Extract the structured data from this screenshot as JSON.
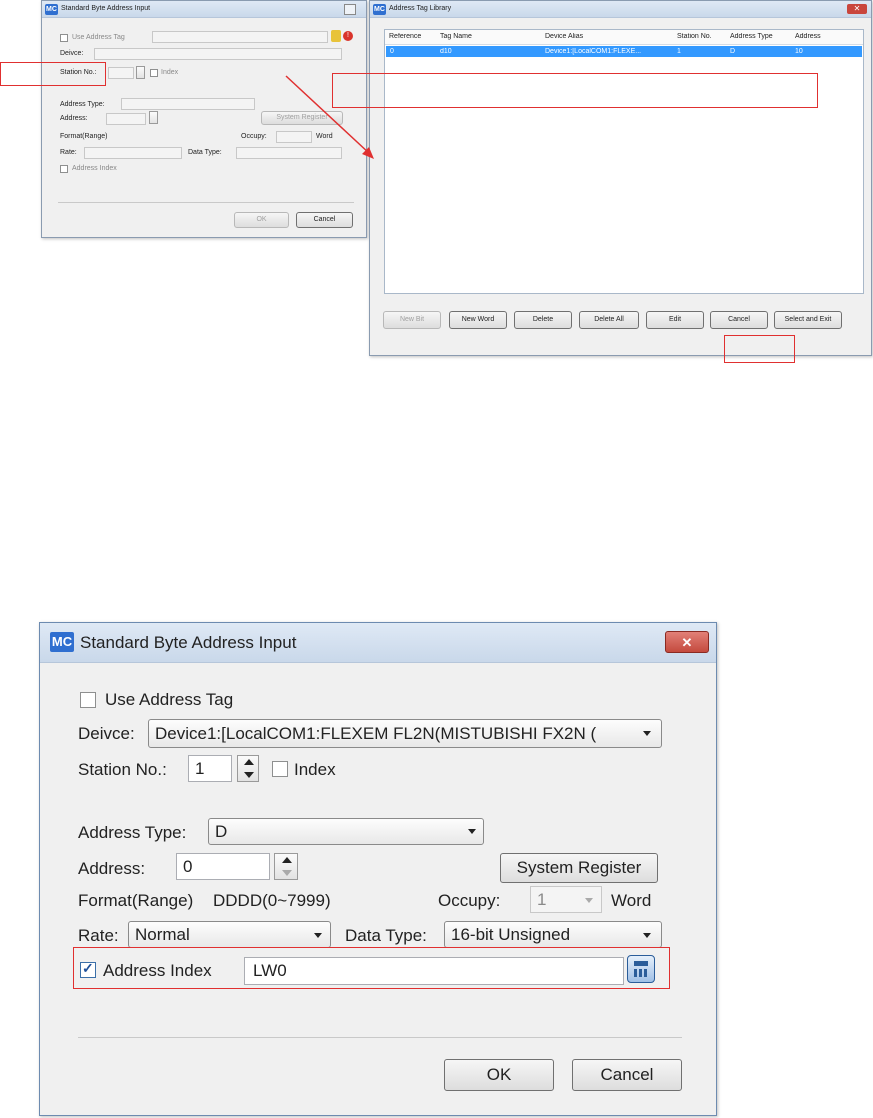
{
  "top_left_dialog": {
    "title": "Standard Byte Address Input",
    "use_address_tag": "Use Address Tag",
    "device_label": "Deivce:",
    "station_label": "Station No.:",
    "index_label": "Index",
    "address_type_label": "Address Type:",
    "address_label": "Address:",
    "system_register": "System Register",
    "format_range_label": "Format(Range)",
    "occupy_label": "Occupy:",
    "word_label": "Word",
    "rate_label": "Rate:",
    "data_type_label": "Data Type:",
    "address_index_label": "Address Index",
    "ok": "OK",
    "cancel": "Cancel"
  },
  "library": {
    "title": "Address Tag Library",
    "columns": [
      "Reference",
      "Tag Name",
      "Device Alias",
      "Station No.",
      "Address Type",
      "Address"
    ],
    "rows": [
      [
        "0",
        "d10",
        "Device1:[LocalCOM1:FLEXE...",
        "1",
        "D",
        "10"
      ]
    ],
    "buttons": {
      "new_bit": "New Bit",
      "new_word": "New Word",
      "delete": "Delete",
      "delete_all": "Delete All",
      "edit": "Edit",
      "cancel": "Cancel",
      "select_exit": "Select and Exit"
    }
  },
  "main_dialog": {
    "title": "Standard Byte Address Input",
    "use_address_tag": "Use Address Tag",
    "device_label": "Deivce:",
    "device_value": "Device1:[LocalCOM1:FLEXEM FL2N(MISTUBISHI FX2N (",
    "station_label": "Station No.:",
    "station_value": "1",
    "index_label": "Index",
    "address_type_label": "Address Type:",
    "address_type_value": "D",
    "address_label": "Address:",
    "address_value": "0",
    "system_register": "System Register",
    "format_label": "Format(Range)",
    "format_value": "DDDD(0~7999)",
    "occupy_label": "Occupy:",
    "occupy_value": "1",
    "word_label": "Word",
    "rate_label": "Rate:",
    "rate_value": "Normal",
    "data_type_label": "Data Type:",
    "data_type_value": "16-bit Unsigned",
    "address_index_label": "Address Index",
    "address_index_value": "LW0",
    "address_index_checked": true,
    "ok": "OK",
    "cancel": "Cancel"
  },
  "icons": {
    "app": "MC",
    "close": "close-icon",
    "calculator": "calculator-icon",
    "spin": "spinner-icon",
    "dropdown": "chevron-down-icon",
    "check": "✓"
  },
  "colors": {
    "highlight": "#e03030",
    "selection": "#3399ff",
    "close_button": "#c9463d",
    "app_icon": "#2f6fd0"
  }
}
